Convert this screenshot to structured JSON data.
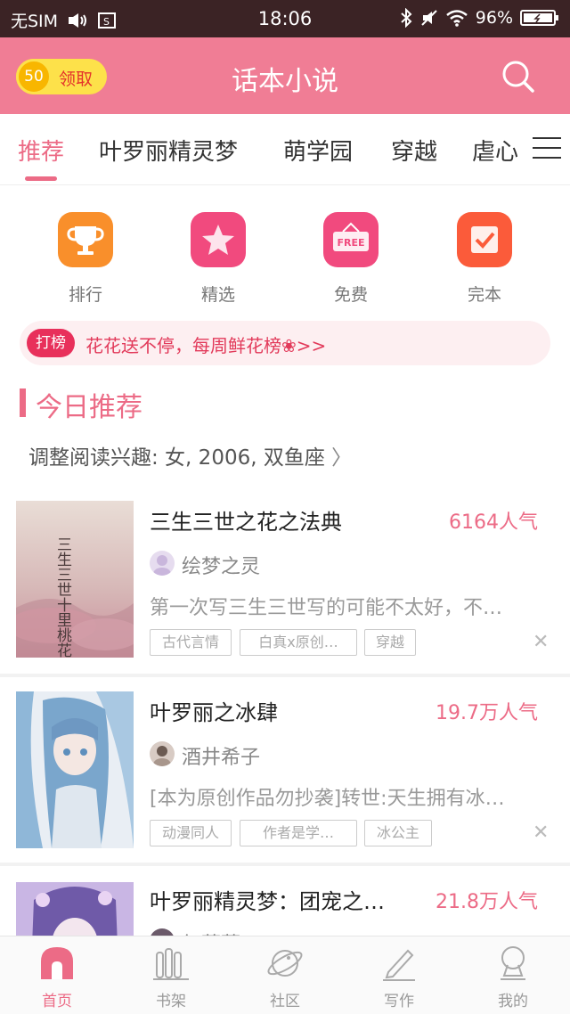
{
  "status_bar": {
    "carrier": "无SIM",
    "time": "18:06",
    "battery": "96%"
  },
  "header": {
    "coin_value": "50",
    "coin_label": "领取",
    "title": "话本小说",
    "search_icon": "search-icon"
  },
  "tabs": [
    {
      "label": "推荐",
      "active": true
    },
    {
      "label": "叶罗丽精灵梦",
      "active": false
    },
    {
      "label": "萌学园",
      "active": false
    },
    {
      "label": "穿越",
      "active": false
    },
    {
      "label": "虐心",
      "active": false
    }
  ],
  "entries": [
    {
      "label": "排行",
      "icon": "trophy-icon",
      "color": "#f98f2b"
    },
    {
      "label": "精选",
      "icon": "star-icon",
      "color": "#f14a7e"
    },
    {
      "label": "免费",
      "icon": "free-sign-icon",
      "color": "#f14a7e"
    },
    {
      "label": "完本",
      "icon": "checkmark-icon",
      "color": "#fb5b3a"
    }
  ],
  "banner": {
    "tag": "打榜",
    "text": "花花送不停，每周鲜花榜❀>>"
  },
  "section": {
    "title": "今日推荐",
    "interest": "调整阅读兴趣: 女, 2006, 双鱼座"
  },
  "books": [
    {
      "title": "三生三世之花之法典",
      "popularity": "6164人气",
      "author": "绘梦之灵",
      "description": "第一次写三生三世写的可能不太好，不…",
      "tags": [
        "古代言情",
        "白真x原创…",
        "穿越"
      ],
      "cover_text": "三生三世十里桃花"
    },
    {
      "title": "叶罗丽之冰肆",
      "popularity": "19.7万人气",
      "author": "酒井希子",
      "description": "[本为原创作品勿抄袭]转世:天生拥有冰…",
      "tags": [
        "动漫同人",
        "作者是学…",
        "冰公主"
      ]
    },
    {
      "title": "叶罗丽精灵梦：团宠之…",
      "popularity": "21.8万人气",
      "author": "红蔷薇"
    }
  ],
  "bottom_nav": [
    {
      "label": "首页",
      "icon": "home-icon",
      "active": true
    },
    {
      "label": "书架",
      "icon": "bookshelf-icon",
      "active": false
    },
    {
      "label": "社区",
      "icon": "planet-icon",
      "active": false
    },
    {
      "label": "写作",
      "icon": "pen-icon",
      "active": false
    },
    {
      "label": "我的",
      "icon": "profile-icon",
      "active": false
    }
  ],
  "colors": {
    "accent": "#ec6b86",
    "header_bg": "#f07d95",
    "status_bg": "#3b2325"
  }
}
